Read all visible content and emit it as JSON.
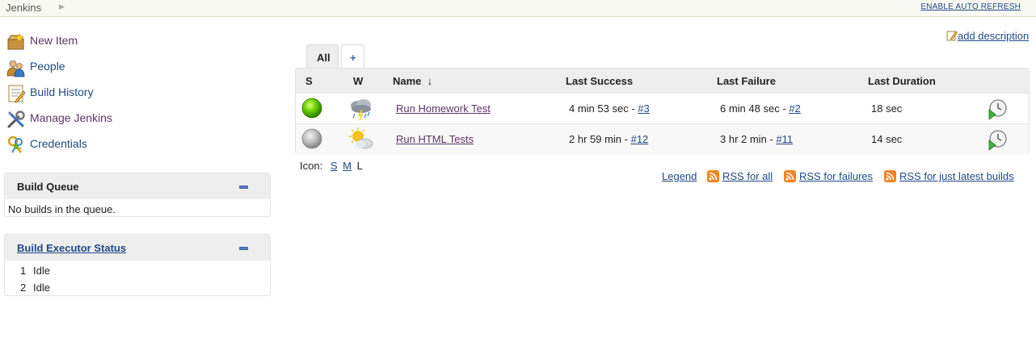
{
  "breadcrumb": {
    "root": "Jenkins",
    "auto_refresh": "ENABLE AUTO REFRESH"
  },
  "tasks": [
    {
      "label": "New Item",
      "icon": "new-item-icon"
    },
    {
      "label": "People",
      "icon": "people-icon"
    },
    {
      "label": "Build History",
      "icon": "build-history-icon"
    },
    {
      "label": "Manage Jenkins",
      "icon": "manage-jenkins-icon"
    },
    {
      "label": "Credentials",
      "icon": "credentials-icon"
    }
  ],
  "build_queue": {
    "title": "Build Queue",
    "empty_text": "No builds in the queue."
  },
  "executors": {
    "title": "Build Executor Status",
    "items": [
      {
        "num": "1",
        "state": "Idle"
      },
      {
        "num": "2",
        "state": "Idle"
      }
    ]
  },
  "main": {
    "add_description": "add description",
    "tabs": [
      {
        "label": "All"
      },
      {
        "label": "+"
      }
    ],
    "columns": {
      "s": "S",
      "w": "W",
      "name": "Name",
      "sort_arrow": "↓",
      "last_success": "Last Success",
      "last_failure": "Last Failure",
      "last_duration": "Last Duration"
    },
    "jobs": [
      {
        "status": "success",
        "status_color": "#5cc200",
        "weather": "stormy",
        "name": "Run Homework Test",
        "last_success_text": "4 min 53 sec - ",
        "last_success_link": "#3",
        "last_failure_text": "6 min 48 sec - ",
        "last_failure_link": "#2",
        "duration": "18 sec"
      },
      {
        "status": "not-built",
        "status_color": "#b0b0b0",
        "weather": "partly-cloudy",
        "name": "Run HTML Tests",
        "last_success_text": "2 hr 59 min - ",
        "last_success_link": "#12",
        "last_failure_text": "3 hr 2 min - ",
        "last_failure_link": "#11",
        "duration": "14 sec"
      }
    ],
    "icon_size": {
      "label": "Icon:",
      "s": "S",
      "m": "M",
      "l": "L"
    },
    "footer": {
      "legend": "Legend",
      "rss_all": "RSS for all",
      "rss_failures": "RSS for failures",
      "rss_latest": "RSS for just latest builds"
    }
  },
  "colors": {
    "link": "#204a87",
    "visited": "#5c3566",
    "rss": "#f58220",
    "header_bg": "#eeeeee"
  }
}
